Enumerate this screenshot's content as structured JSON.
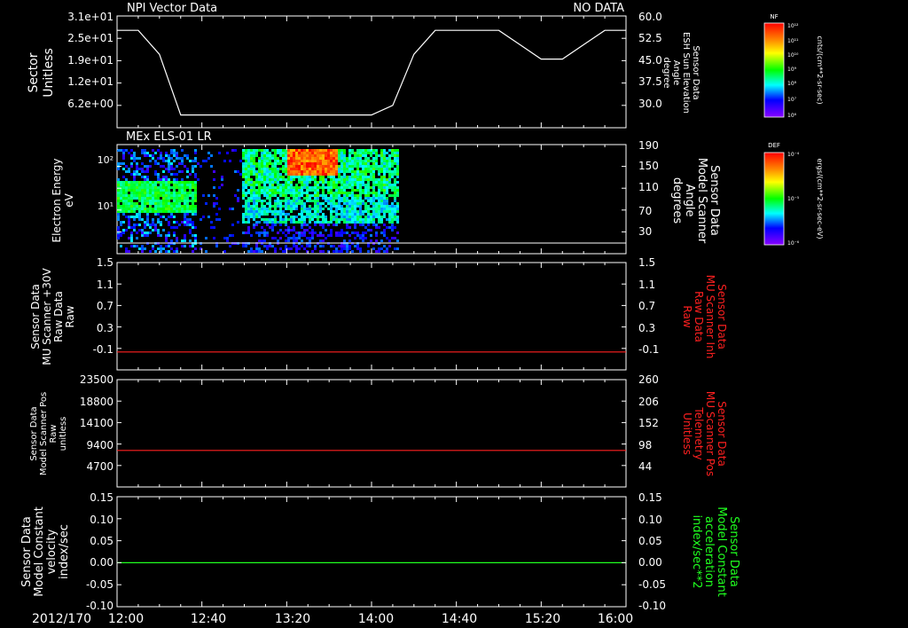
{
  "top_title_left": "NPI Vector Data",
  "top_title_right": "NO DATA",
  "date_label": "2012/170",
  "colors": {
    "background": "#000000",
    "axes": "#ffffff",
    "red_trace": "#ff2020",
    "green_trace": "#20ff20",
    "red_label": "#ff2020",
    "green_label": "#20ff20"
  },
  "chart_data": [
    {
      "type": "line",
      "panel": "sector",
      "ylabel_left": [
        "Sector",
        "Unitless"
      ],
      "ylabel_right": [
        "Sensor Data",
        "ESH Sun Elevation",
        "Angle",
        "degree"
      ],
      "ticks_left": [
        "3.1e+01",
        "2.5e+01",
        "1.9e+01",
        "1.2e+01",
        "6.2e+00"
      ],
      "ticks_right": [
        "60.0",
        "52.5",
        "45.0",
        "37.5",
        "30.0"
      ],
      "ylim_right": [
        25.0,
        60.0
      ],
      "series": [
        {
          "color": "#ffffff",
          "x": [
            "12:00",
            "12:10",
            "12:20",
            "12:30",
            "12:40",
            "13:00",
            "13:20",
            "13:40",
            "14:00",
            "14:10",
            "14:20",
            "14:30",
            "14:40",
            "15:00",
            "15:10",
            "15:20",
            "15:30",
            "15:40",
            "15:50",
            "16:00"
          ],
          "y": [
            55.5,
            55.5,
            48.0,
            29.0,
            29.0,
            29.0,
            29.0,
            29.0,
            29.0,
            32.0,
            48.0,
            55.5,
            55.5,
            55.5,
            51.0,
            46.5,
            46.5,
            51.0,
            55.5,
            55.5
          ]
        }
      ]
    },
    {
      "type": "heatmap",
      "panel": "els",
      "title": "MEx ELS-01 LR",
      "ylabel_left": [
        "Electron Energy",
        "eV"
      ],
      "ylabel_right": [
        "Sensor Data",
        "Model Scanner",
        "Angle",
        "degrees"
      ],
      "ticks_left": [
        "10²",
        "10¹"
      ],
      "ticks_right": [
        "190",
        "150",
        "110",
        "70",
        "30"
      ],
      "ylim_right": [
        10,
        190
      ],
      "scanner_angle_trace": {
        "color": "#ffffff",
        "value": 10
      },
      "data_x_range": [
        "12:00",
        "14:12"
      ],
      "color_key": {
        "label": "DEF",
        "unit": "ergs/(cm**2-sr-sec-eV)"
      }
    },
    {
      "type": "line",
      "panel": "mu_scanner_raw",
      "ylabel_left": [
        "Sensor Data",
        "MU Scanner +30V",
        "Raw Data",
        "Raw"
      ],
      "ylabel_right": [
        "Sensor Data",
        "MU Scanner Inh",
        "Raw Data",
        "Raw"
      ],
      "ticks_left": [
        "1.5",
        "1.1",
        "0.7",
        "0.3",
        "-0.1"
      ],
      "ticks_right": [
        "1.5",
        "1.1",
        "0.7",
        "0.3",
        "-0.1"
      ],
      "ylim": [
        -0.3,
        1.5
      ],
      "series": [
        {
          "color": "#ff2020",
          "x": [
            "12:00",
            "16:00"
          ],
          "y": [
            0.0,
            0.0
          ]
        }
      ]
    },
    {
      "type": "line",
      "panel": "scanner_pos",
      "ylabel_left": [
        "Sensor Data",
        "Model Scanner Pos",
        "Raw",
        "unitless"
      ],
      "ylabel_right": [
        "Sensor Data",
        "MU Scanner Pos",
        "Telemetry",
        "Unitless"
      ],
      "ticks_left": [
        "23500",
        "18800",
        "14100",
        "9400",
        "4700"
      ],
      "ticks_right": [
        "260",
        "206",
        "152",
        "98",
        "44"
      ],
      "ylim": [
        0,
        23500
      ],
      "series": [
        {
          "color": "#ff2020",
          "x": [
            "12:00",
            "16:00"
          ],
          "y": [
            8000,
            8000
          ]
        }
      ]
    },
    {
      "type": "line",
      "panel": "velocity",
      "ylabel_left": [
        "Sensor Data",
        "Model Constant",
        "velocity",
        "index/sec"
      ],
      "ylabel_right": [
        "Sensor Data",
        "Model Constant",
        "acceleration",
        "index/sec**2"
      ],
      "ticks_left": [
        "0.15",
        "0.10",
        "0.05",
        "0.00",
        "-0.05",
        "-0.10"
      ],
      "ticks_right": [
        "0.15",
        "0.10",
        "0.05",
        "0.00",
        "-0.05",
        "-0.10"
      ],
      "ylim": [
        -0.1,
        0.15
      ],
      "series": [
        {
          "color": "#20ff20",
          "x": [
            "12:00",
            "16:00"
          ],
          "y": [
            0.0,
            0.0
          ]
        }
      ]
    }
  ],
  "x_axis": {
    "ticks": [
      "12:00",
      "12:40",
      "13:20",
      "14:00",
      "14:40",
      "15:20",
      "16:00"
    ],
    "range": [
      "12:00",
      "16:00"
    ]
  },
  "colorbar_nf": {
    "label": "NF",
    "unit": "cnts/(cm**2-sr-sec)",
    "ticks": [
      "10¹²",
      "10¹¹",
      "10¹⁰",
      "10⁹",
      "10⁸",
      "10⁷",
      "10⁶"
    ]
  },
  "colorbar_def": {
    "label": "DEF",
    "unit": "ergs/(cm**2-sr-sec-eV)",
    "ticks": [
      "10⁻⁴",
      "10⁻⁵",
      "10⁻⁶"
    ]
  }
}
